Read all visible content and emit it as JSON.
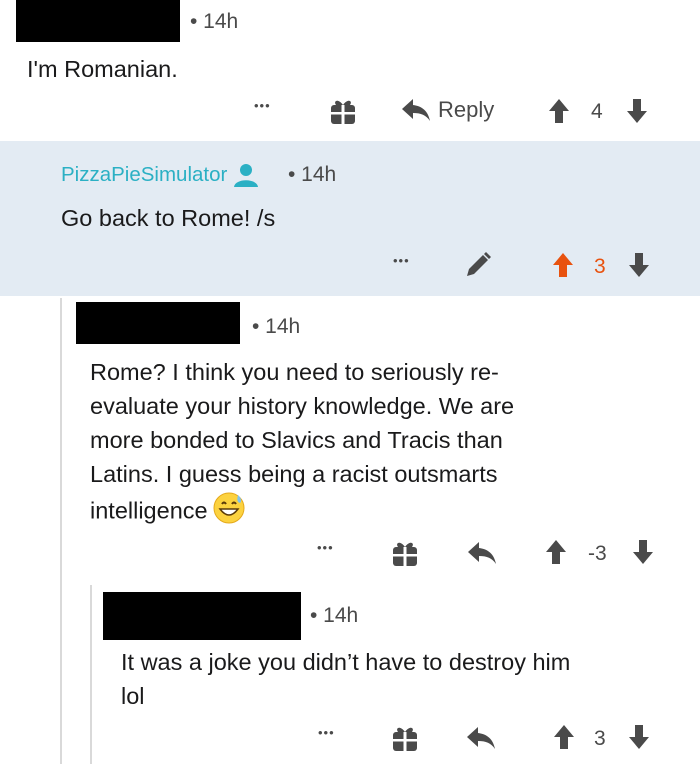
{
  "comments": [
    {
      "time": "• 14h",
      "text": "I'm Romanian.",
      "actions": {
        "more": "•••",
        "reply": "Reply",
        "score": "4"
      }
    },
    {
      "username": "PizzaPieSimulator",
      "time": "• 14h",
      "text": "Go back to Rome! /s",
      "actions": {
        "more": "•••",
        "score": "3"
      },
      "colors": {
        "highlight_bg": "#e3ebf3",
        "username": "#2bb0c4",
        "upvote": "#e8520f"
      }
    },
    {
      "time": "• 14h",
      "text_lines": [
        "Rome? I think you need to seriously re-",
        "evaluate your history knowledge. We are",
        "more bonded to Slavics and Tracis than",
        "Latins. I guess being a racist outsmarts",
        "intelligence"
      ],
      "emoji": "grinning-sweat-emoji",
      "actions": {
        "more": "•••",
        "score": "-3"
      }
    },
    {
      "time": "• 14h",
      "text_lines": [
        "It was a joke you didn’t have to destroy him",
        "lol"
      ],
      "actions": {
        "more": "•••",
        "score": "3"
      }
    }
  ]
}
